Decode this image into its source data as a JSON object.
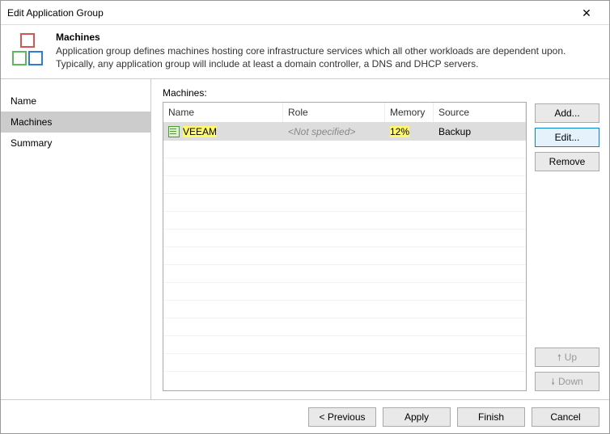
{
  "window": {
    "title": "Edit Application Group"
  },
  "header": {
    "title": "Machines",
    "desc": "Application group defines machines hosting core infrastructure services which all other workloads are dependent upon. Typically, any application group will include at least a domain controller, a DNS and DHCP servers."
  },
  "sidebar": {
    "items": [
      "Name",
      "Machines",
      "Summary"
    ],
    "selected": 1
  },
  "table": {
    "label": "Machines:",
    "columns": {
      "name": "Name",
      "role": "Role",
      "memory": "Memory",
      "source": "Source"
    },
    "rows": [
      {
        "name": "VEEAM",
        "role": "<Not specified>",
        "memory": "12%",
        "source": "Backup"
      }
    ]
  },
  "buttons": {
    "add": "Add...",
    "edit": "Edit...",
    "remove": "Remove",
    "up": "Up",
    "down": "Down",
    "previous": "< Previous",
    "apply": "Apply",
    "finish": "Finish",
    "cancel": "Cancel"
  }
}
